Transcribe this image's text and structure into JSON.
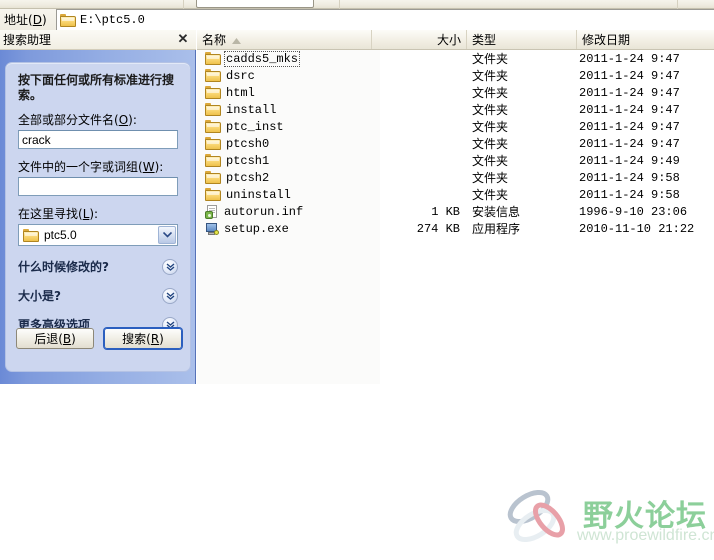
{
  "window": {
    "address_label": "地址(D)",
    "address_value": "E:\\ptc5.0",
    "address_icon": "folder-icon"
  },
  "search_companion": {
    "title": "搜索助理",
    "close_icon": "close-icon",
    "lead_text": "按下面任何或所有标准进行搜索。",
    "filename_label": "全部或部分文件名(O):",
    "filename_value": "crack",
    "filename_placeholder": "",
    "word_label": "文件中的一个字或词组(W):",
    "word_value": "",
    "word_placeholder": "",
    "lookin_label": "在这里寻找(L):",
    "lookin_value": "ptc5.0",
    "lookin_icon": "folder-icon",
    "lookin_arrow_icon": "chevron-down-icon",
    "sections": [
      {
        "label": "什么时候修改的?",
        "icon": "chevron-down-icon"
      },
      {
        "label": "大小是?",
        "icon": "chevron-down-icon"
      },
      {
        "label": "更多高级选项",
        "icon": "chevron-down-icon"
      }
    ],
    "back_button": "后退(B)",
    "search_button": "搜索(R)"
  },
  "file_list": {
    "columns": [
      "名称",
      "大小",
      "类型",
      "修改日期"
    ],
    "sort_column": "名称",
    "sort_icon": "sort-ascending-icon",
    "focused_row": "cadds5_mks",
    "rows": [
      {
        "name": "cadds5_mks",
        "size": "",
        "type": "文件夹",
        "date": "2011-1-24  9:47",
        "icon": "folder-icon"
      },
      {
        "name": "dsrc",
        "size": "",
        "type": "文件夹",
        "date": "2011-1-24  9:47",
        "icon": "folder-icon"
      },
      {
        "name": "html",
        "size": "",
        "type": "文件夹",
        "date": "2011-1-24  9:47",
        "icon": "folder-icon"
      },
      {
        "name": "install",
        "size": "",
        "type": "文件夹",
        "date": "2011-1-24  9:47",
        "icon": "folder-icon"
      },
      {
        "name": "ptc_inst",
        "size": "",
        "type": "文件夹",
        "date": "2011-1-24  9:47",
        "icon": "folder-icon"
      },
      {
        "name": "ptcsh0",
        "size": "",
        "type": "文件夹",
        "date": "2011-1-24  9:47",
        "icon": "folder-icon"
      },
      {
        "name": "ptcsh1",
        "size": "",
        "type": "文件夹",
        "date": "2011-1-24  9:49",
        "icon": "folder-icon"
      },
      {
        "name": "ptcsh2",
        "size": "",
        "type": "文件夹",
        "date": "2011-1-24  9:58",
        "icon": "folder-icon"
      },
      {
        "name": "uninstall",
        "size": "",
        "type": "文件夹",
        "date": "2011-1-24  9:58",
        "icon": "folder-icon"
      },
      {
        "name": "autorun.inf",
        "size": "1 KB",
        "type": "安装信息",
        "date": "1996-9-10 23:06",
        "icon": "inf-file-icon"
      },
      {
        "name": "setup.exe",
        "size": "274 KB",
        "type": "应用程序",
        "date": "2010-11-10 21:22",
        "icon": "exe-file-icon"
      }
    ]
  },
  "watermark": {
    "text": "野火论坛",
    "url": "www.proewildfire.cn"
  },
  "colors": {
    "panel_blue": "#95aee4",
    "panel_inner": "#ccd6ef",
    "toolbar": "#efece1",
    "watermark_green": "#8ccf9a"
  }
}
